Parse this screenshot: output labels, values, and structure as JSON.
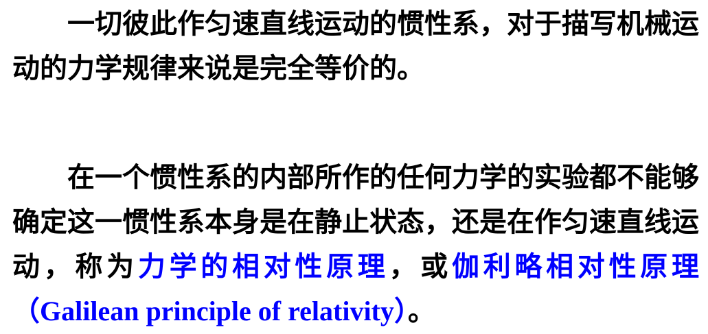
{
  "paragraph1": {
    "text": "一切彼此作匀速直线运动的惯性系，对于描写机械运动的力学规律来说是完全等价的。"
  },
  "paragraph2": {
    "lead": "在一个惯性系的内部所作的任何力学的实验都不能够确定这一惯性系本身是在静止状态，还是在作匀速直线运动，称为",
    "term1": "力学的相对性原理",
    "sep": "，或",
    "term2": "伽利略相对性原理",
    "paren_open": "（",
    "term2_english": "Galilean principle of relativity",
    "paren_close": "）",
    "end": "。"
  },
  "colors": {
    "text": "#000000",
    "highlight": "#0000ff",
    "background": "#ffffff"
  }
}
